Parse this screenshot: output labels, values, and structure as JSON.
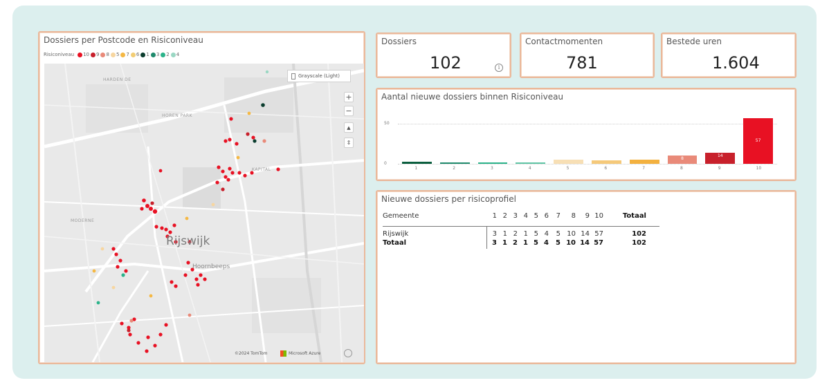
{
  "map_card": {
    "title": "Dossiers per Postcode en Risiconiveau",
    "legend_label": "Risiconiveau",
    "legend_items": [
      {
        "label": "10",
        "color": "#e81123"
      },
      {
        "label": "9",
        "color": "#c8202b"
      },
      {
        "label": "8",
        "color": "#e98a79"
      },
      {
        "label": "5",
        "color": "#f7d6a0"
      },
      {
        "label": "7",
        "color": "#f5b844"
      },
      {
        "label": "6",
        "color": "#f2cd74"
      },
      {
        "label": "1",
        "color": "#0b3d2e"
      },
      {
        "label": "3",
        "color": "#1f8a6c"
      },
      {
        "label": "2",
        "color": "#2bb38a"
      },
      {
        "label": "4",
        "color": "#9ad7c3"
      }
    ],
    "map_style_button": "Grayscale (Light)",
    "zoom_in": "+",
    "zoom_out": "−",
    "compass_up": "▲",
    "compass_tilt": "⇕",
    "city_label": "Rijswijk",
    "district_label": "Hoornbeeps",
    "attribution_tomtom": "©2024 TomTom",
    "attribution_azure": "Microsoft Azure"
  },
  "kpis": [
    {
      "label": "Dossiers",
      "value": "102",
      "info_icon": "i"
    },
    {
      "label": "Contactmomenten",
      "value": "781"
    },
    {
      "label": "Bestede uren",
      "value": "1.604"
    }
  ],
  "bar_card": {
    "title": "Aantal nieuwe dossiers binnen Risiconiveau"
  },
  "chart_data": {
    "type": "bar",
    "title": "Aantal nieuwe dossiers binnen Risiconiveau",
    "categories": [
      "1",
      "2",
      "3",
      "4",
      "5",
      "6",
      "7",
      "8",
      "9",
      "10"
    ],
    "values": [
      3,
      1,
      2,
      1,
      5,
      4,
      5,
      10,
      14,
      57
    ],
    "colors": [
      "#0b5e3e",
      "#1f8a6c",
      "#2bb38a",
      "#5fc4a5",
      "#f7dfb5",
      "#f5c97a",
      "#f3b13f",
      "#e98a79",
      "#c8202b",
      "#e81123"
    ],
    "data_labels": [
      "",
      "",
      "",
      "",
      "",
      "",
      "",
      "8",
      "14",
      "57"
    ],
    "yticks": [
      "50",
      "0"
    ],
    "ylim": [
      0,
      60
    ],
    "grid": true
  },
  "table_card": {
    "title": "Nieuwe dossiers per risicoprofiel",
    "header": [
      "Gemeente",
      "1",
      "2",
      "3",
      "4",
      "5",
      "6",
      "7",
      "8",
      "9",
      "10",
      "Totaal"
    ],
    "rows": [
      {
        "name": "Rijswijk",
        "values": [
          "3",
          "1",
          "2",
          "1",
          "5",
          "4",
          "5",
          "10",
          "14",
          "57",
          "102"
        ]
      },
      {
        "name": "Totaal",
        "values": [
          "3",
          "1",
          "2",
          "1",
          "5",
          "4",
          "5",
          "10",
          "14",
          "57",
          "102"
        ]
      }
    ]
  }
}
